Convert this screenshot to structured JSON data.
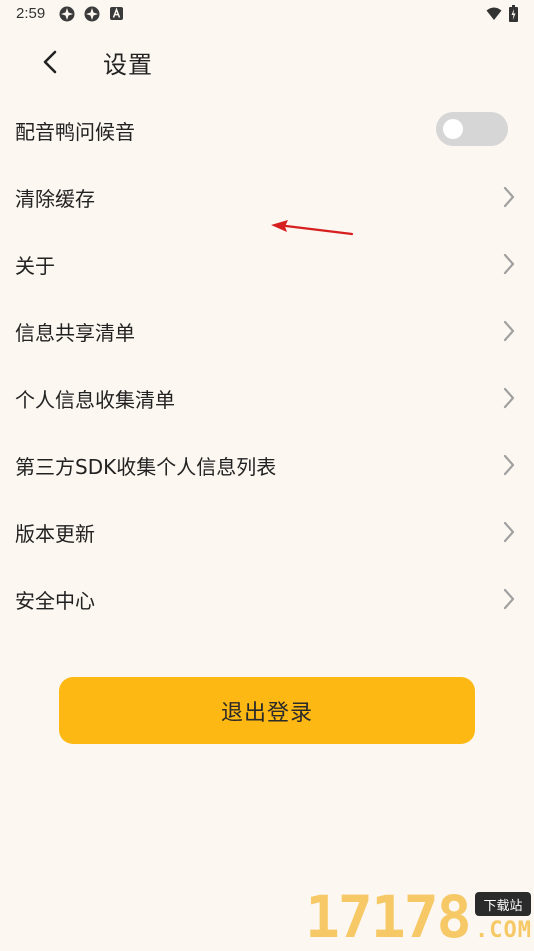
{
  "status_bar": {
    "time": "2:59",
    "icons": [
      "app-notification-icon",
      "app-notification-icon",
      "a-notification-icon",
      "wifi-icon",
      "battery-icon"
    ]
  },
  "header": {
    "back_icon": "chevron-left-icon",
    "title": "设置"
  },
  "settings": [
    {
      "label": "配音鸭问候音",
      "control": "toggle",
      "enabled": false
    },
    {
      "label": "清除缓存",
      "control": "chevron"
    },
    {
      "label": "关于",
      "control": "chevron"
    },
    {
      "label": "信息共享清单",
      "control": "chevron"
    },
    {
      "label": "个人信息收集清单",
      "control": "chevron"
    },
    {
      "label": "第三方SDK收集个人信息列表",
      "control": "chevron"
    },
    {
      "label": "版本更新",
      "control": "chevron"
    },
    {
      "label": "安全中心",
      "control": "chevron"
    }
  ],
  "logout_button": {
    "label": "退出登录"
  },
  "watermark": {
    "number": "17178",
    "badge": "下载站",
    "suffix": ".COM"
  },
  "colors": {
    "background": "#fcf7f0",
    "accent": "#fdb813",
    "toggle_off": "#d6d6d6",
    "chevron": "#a0a0a0",
    "annotation_arrow": "#d61f1f"
  }
}
